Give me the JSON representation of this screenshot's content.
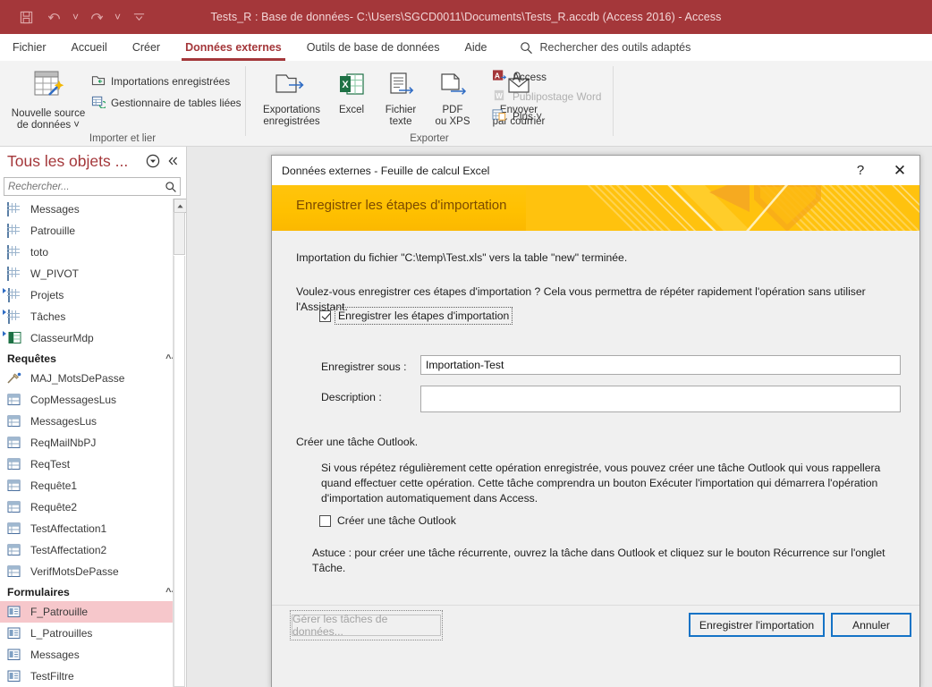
{
  "titlebar": {
    "title": "Tests_R : Base de données- C:\\Users\\SGCD0011\\Documents\\Tests_R.accdb (Access 2016)  -  Access",
    "quick_access": [
      "save-icon",
      "undo-icon",
      "redo-icon",
      "customize-qat-icon"
    ]
  },
  "ribbon": {
    "tabs": [
      {
        "label": "Fichier",
        "active": false
      },
      {
        "label": "Accueil",
        "active": false
      },
      {
        "label": "Créer",
        "active": false
      },
      {
        "label": "Données externes",
        "active": true
      },
      {
        "label": "Outils de base de données",
        "active": false
      },
      {
        "label": "Aide",
        "active": false
      }
    ],
    "tellme_placeholder": "Rechercher des outils adaptés",
    "groups": [
      {
        "label": "Importer et lier",
        "big_buttons": [
          {
            "label1": "Nouvelle source",
            "label2": "de données ˅",
            "icon": "new-data-source-icon"
          }
        ],
        "small_items": [
          {
            "label": "Importations enregistrées",
            "icon": "saved-imports-icon",
            "disabled": false
          },
          {
            "label": "Gestionnaire de tables liées",
            "icon": "linked-table-manager-icon",
            "disabled": false
          }
        ]
      },
      {
        "label": "Exporter",
        "big_buttons": [
          {
            "label1": "Exportations",
            "label2": "enregistrées",
            "icon": "saved-exports-icon"
          },
          {
            "label1": "Excel",
            "label2": "",
            "icon": "excel-icon"
          },
          {
            "label1": "Fichier",
            "label2": "texte",
            "icon": "text-file-icon"
          },
          {
            "label1": "PDF",
            "label2": "ou XPS",
            "icon": "pdf-xps-icon"
          },
          {
            "label1": "Envoyer",
            "label2": "par courrier",
            "icon": "email-icon"
          }
        ],
        "small_items": [
          {
            "label": "Access",
            "icon": "access-icon",
            "disabled": false
          },
          {
            "label": "Publipostage Word",
            "icon": "word-merge-icon",
            "disabled": true
          },
          {
            "label": "Plus ˅",
            "icon": "more-icon",
            "disabled": false
          }
        ]
      }
    ]
  },
  "navpane": {
    "title": "Tous les objets ...",
    "menu_icon": "chevron-circle-down-icon",
    "collapse_icon": "double-chevron-left-icon",
    "search_placeholder": "Rechercher...",
    "search_value": "",
    "search_icon": "search-icon",
    "sections": [
      {
        "type": "items",
        "items": [
          {
            "label": "Messages",
            "icon": "table-icon",
            "selected": false
          },
          {
            "label": "Patrouille",
            "icon": "table-icon",
            "selected": false
          },
          {
            "label": "toto",
            "icon": "table-icon",
            "selected": false
          },
          {
            "label": "W_PIVOT",
            "icon": "table-icon",
            "selected": false
          },
          {
            "label": "Projets",
            "icon": "linked-table-icon",
            "selected": false
          },
          {
            "label": "Tâches",
            "icon": "linked-table-icon",
            "selected": false
          },
          {
            "label": "ClasseurMdp",
            "icon": "linked-excel-icon",
            "selected": false
          }
        ]
      },
      {
        "type": "group",
        "label": "Requêtes",
        "items": [
          {
            "label": "MAJ_MotsDePasse",
            "icon": "update-query-icon",
            "selected": false
          },
          {
            "label": "CopMessagesLus",
            "icon": "query-icon",
            "selected": false
          },
          {
            "label": "MessagesLus",
            "icon": "query-icon",
            "selected": false
          },
          {
            "label": "ReqMailNbPJ",
            "icon": "query-icon",
            "selected": false
          },
          {
            "label": "ReqTest",
            "icon": "query-icon",
            "selected": false
          },
          {
            "label": "Requête1",
            "icon": "query-icon",
            "selected": false
          },
          {
            "label": "Requête2",
            "icon": "query-icon",
            "selected": false
          },
          {
            "label": "TestAffectation1",
            "icon": "query-icon",
            "selected": false
          },
          {
            "label": "TestAffectation2",
            "icon": "query-icon",
            "selected": false
          },
          {
            "label": "VerifMotsDePasse",
            "icon": "query-icon",
            "selected": false
          }
        ]
      },
      {
        "type": "group",
        "label": "Formulaires",
        "items": [
          {
            "label": "F_Patrouille",
            "icon": "form-icon",
            "selected": true
          },
          {
            "label": "L_Patrouilles",
            "icon": "form-icon",
            "selected": false
          },
          {
            "label": "Messages",
            "icon": "form-icon",
            "selected": false
          },
          {
            "label": "TestFiltre",
            "icon": "form-icon",
            "selected": false
          }
        ]
      }
    ]
  },
  "dialog": {
    "title": "Données externes - Feuille de calcul Excel",
    "help_icon": "?",
    "close_icon": "✕",
    "banner_title": "Enregistrer les étapes d'importation",
    "completion_text": "Importation du fichier \"C:\\temp\\Test.xls\" vers la table \"new\" terminée.",
    "question_text": "Voulez-vous enregistrer ces étapes d'importation ? Cela vous permettra de répéter rapidement l'opération sans utiliser l'Assistant.",
    "save_steps_checkbox": {
      "label": "Enregistrer les étapes d'importation",
      "checked": true,
      "focused": true
    },
    "save_as_label": "Enregistrer sous :",
    "save_as_value": "Importation-Test",
    "description_label": "Description :",
    "description_value": "",
    "outlook_section_title": "Créer une tâche Outlook.",
    "outlook_paragraph": "Si vous répétez régulièrement cette opération enregistrée, vous pouvez créer une tâche Outlook qui vous rappellera quand effectuer cette opération. Cette tâche comprendra un bouton Exécuter l'importation qui démarrera l'opération d'importation automatiquement dans Access.",
    "outlook_checkbox": {
      "label": "Créer une tâche Outlook",
      "checked": false
    },
    "tip_text": "Astuce : pour créer une tâche récurrente, ouvrez la tâche dans Outlook et cliquez sur le bouton Récurrence sur l'onglet Tâche.",
    "buttons": {
      "manage_tasks": {
        "label": "Gérer les tâches de données...",
        "disabled": true
      },
      "save_import": {
        "label": "Enregistrer l'importation",
        "primary": true
      },
      "cancel": {
        "label": "Annuler",
        "primary": true
      }
    }
  },
  "colors": {
    "title_bar": "#A4373A",
    "accent_red": "#A4373A",
    "banner_yellow": "#FFC40D",
    "banner_text": "#7B4A00",
    "selection_pink": "#F6C7CB",
    "primary_border_blue": "#1573C6",
    "ribbon_bg": "#F3F3F3",
    "workspace_bg": "#E9E9E9",
    "dialog_bg": "#F0F0F0"
  }
}
